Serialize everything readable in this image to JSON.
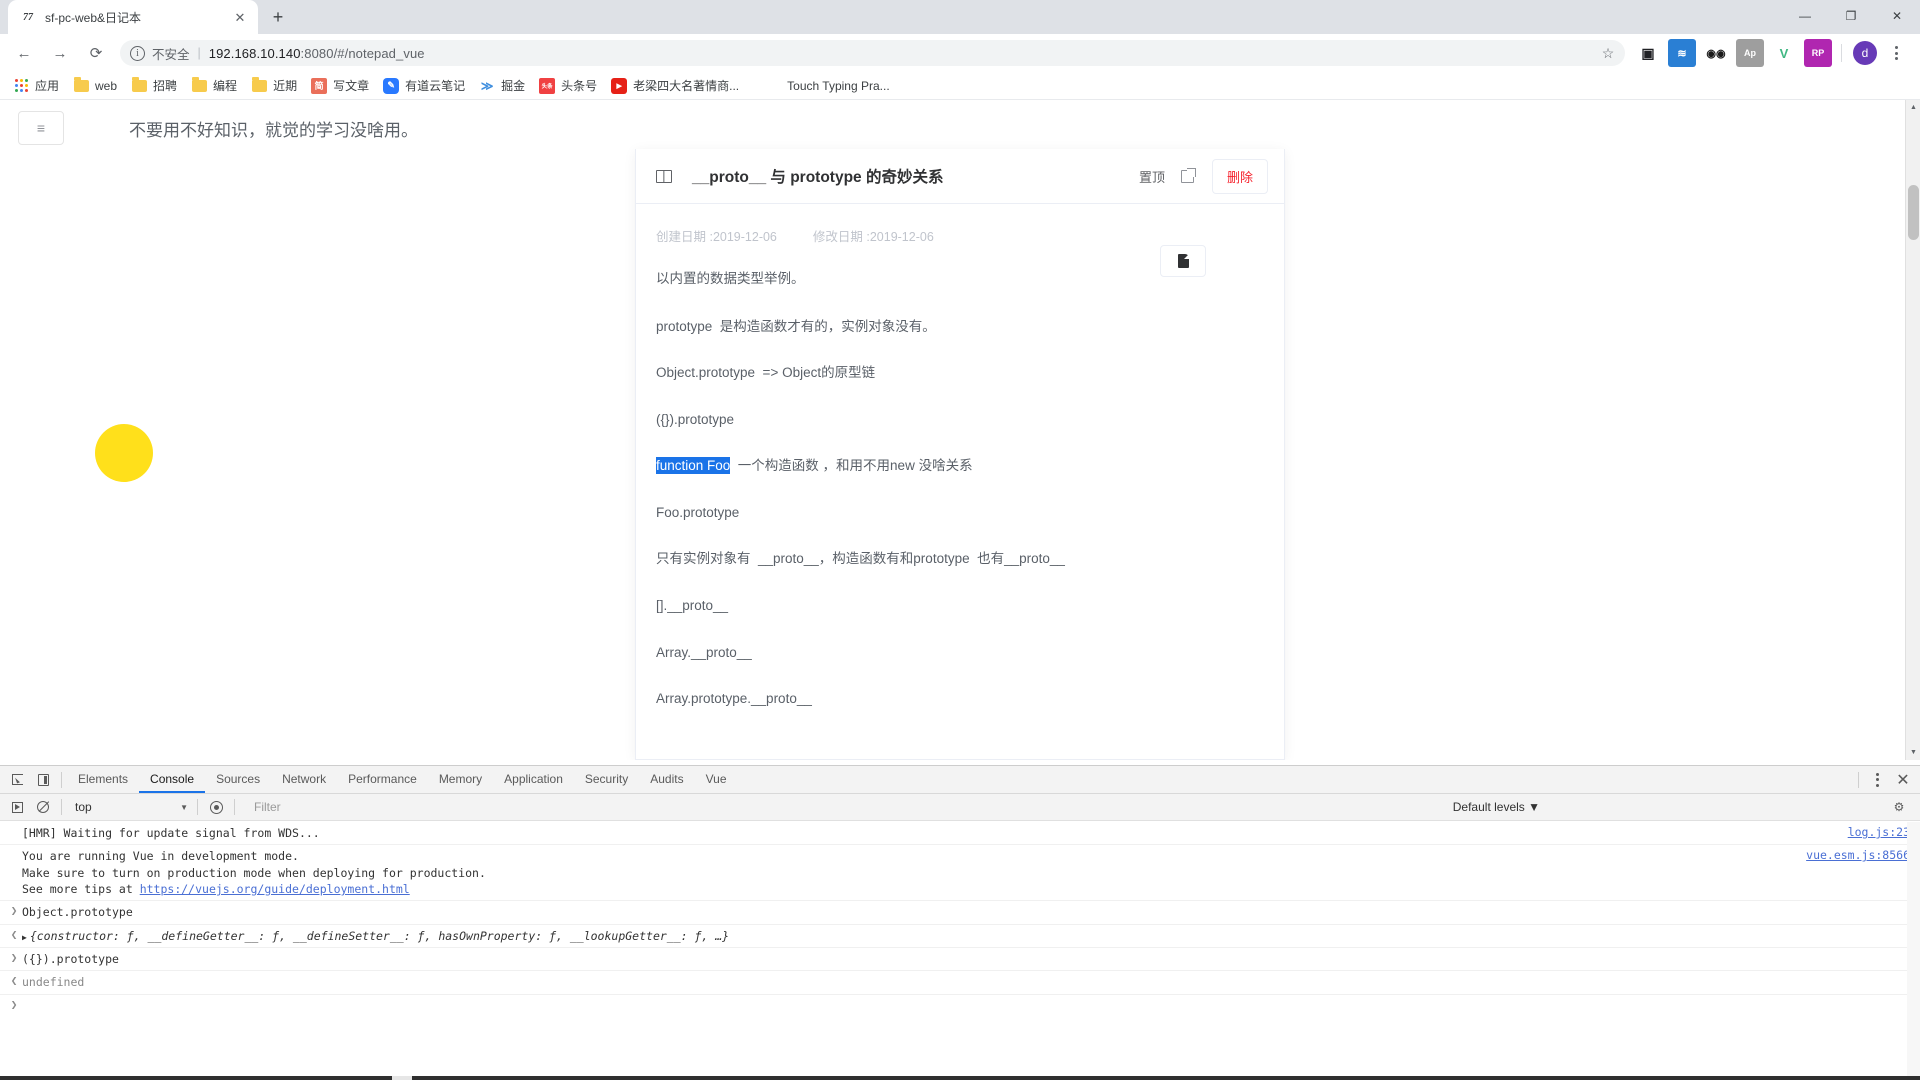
{
  "browser": {
    "tab": {
      "favicon": "77",
      "title": "sf-pc-web&日记本",
      "close_label": "✕"
    },
    "newtab_label": "+",
    "window_controls": {
      "minimize": "—",
      "maximize": "❐",
      "close": "✕"
    },
    "nav": {
      "back": "←",
      "forward": "→",
      "reload": "⟳"
    },
    "omnibox": {
      "info_icon": "i",
      "security_text": "不安全",
      "separator": "|",
      "url_host": "192.168.10.140",
      "url_rest": ":8080/#/notepad_vue",
      "star_icon": "☆"
    },
    "extensions": [
      {
        "name": "picture-in-picture-extension",
        "label": "▣",
        "bg": "#ffffff",
        "fg": "#202124"
      },
      {
        "name": "wps-extension",
        "label": "≋",
        "bg": "#2a7fd4",
        "fg": "#ffffff"
      },
      {
        "name": "glasses-extension",
        "label": "◉◉",
        "bg": "#ffffff",
        "fg": "#1a1a1a"
      },
      {
        "name": "ap-extension",
        "label": "Ap",
        "bg": "#9e9e9e",
        "fg": "#ffffff"
      },
      {
        "name": "vue-devtools-extension",
        "label": "V",
        "bg": "#ffffff",
        "fg": "#41b883"
      },
      {
        "name": "rp-extension",
        "label": "RP",
        "bg": "#b026b0",
        "fg": "#ffffff"
      }
    ],
    "profile_initial": "d",
    "bookmarks": [
      {
        "name": "apps",
        "label": "应用",
        "icon": "apps-grid"
      },
      {
        "name": "web",
        "label": "web",
        "icon": "folder"
      },
      {
        "name": "recruit",
        "label": "招聘",
        "icon": "folder"
      },
      {
        "name": "programming",
        "label": "编程",
        "icon": "folder"
      },
      {
        "name": "recent",
        "label": "近期",
        "icon": "folder"
      },
      {
        "name": "jianshu",
        "label": "写文章",
        "icon": "简",
        "bg": "#ea6f5a",
        "fg": "#ffffff"
      },
      {
        "name": "youdao",
        "label": "有道云笔记",
        "icon": "✎",
        "bg": "#2979ff",
        "fg": "#ffffff"
      },
      {
        "name": "juejin",
        "label": "掘金",
        "icon": "≫",
        "bg": "#ffffff",
        "fg": "#3f8ede"
      },
      {
        "name": "toutiao",
        "label": "头条号",
        "icon": "头条",
        "bg": "#f04142",
        "fg": "#ffffff"
      },
      {
        "name": "laoliang-video",
        "label": "老梁四大名著情商...",
        "icon": "▶",
        "bg": "#e62117",
        "fg": "#ffffff"
      },
      {
        "name": "touch-typing",
        "label": "Touch Typing Pra...",
        "icon": ""
      }
    ]
  },
  "app": {
    "menu_button_icon": "≡",
    "motto": "不要用不好知识，就觉的学习没啥用。",
    "note": {
      "book_icon": "book-icon",
      "title": "__proto__ 与 prototype 的奇妙关系",
      "pin_label": "置顶",
      "share_icon": "external-link-icon",
      "delete_label": "删除",
      "created_label": "创建日期 :2019-12-06",
      "modified_label": "修改日期 :2019-12-06",
      "copy_icon": "document-copy-icon",
      "lines": [
        {
          "text": "以内置的数据类型举例。",
          "type": "text"
        },
        {
          "text": "",
          "type": "blank"
        },
        {
          "text": "prototype  是构造函数才有的，实例对象没有。",
          "type": "text"
        },
        {
          "text": "Object.prototype  => Object的原型链",
          "type": "text"
        },
        {
          "text": "({}).prototype",
          "type": "text"
        },
        {
          "text": "",
          "type": "selected-line",
          "selected": "function Foo",
          "rest": "  一个构造函数 ，和用不用new 没啥关系"
        },
        {
          "text": "Foo.prototype",
          "type": "text"
        },
        {
          "text": "只有实例对象有  __proto__，构造函数有和prototype  也有__proto__",
          "type": "text"
        },
        {
          "text": "[].__proto__",
          "type": "text"
        },
        {
          "text": "Array.__proto__",
          "type": "text"
        },
        {
          "text": "Array.prototype.__proto__",
          "type": "text"
        }
      ]
    }
  },
  "devtools": {
    "inspect_icon": "inspect-element-icon",
    "device_icon": "device-toolbar-icon",
    "tabs": [
      {
        "label": "Elements",
        "active": false
      },
      {
        "label": "Console",
        "active": true
      },
      {
        "label": "Sources",
        "active": false
      },
      {
        "label": "Network",
        "active": false
      },
      {
        "label": "Performance",
        "active": false
      },
      {
        "label": "Memory",
        "active": false
      },
      {
        "label": "Application",
        "active": false
      },
      {
        "label": "Security",
        "active": false
      },
      {
        "label": "Audits",
        "active": false
      },
      {
        "label": "Vue",
        "active": false
      }
    ],
    "more_icon": "kebab-menu-icon",
    "close_icon": "✕",
    "filterbar": {
      "exec_icon": "execute-icon",
      "clear_icon": "clear-console-icon",
      "context": "top",
      "context_caret": "▼",
      "eye_icon": "live-expression-icon",
      "filter_placeholder": "Filter",
      "levels": "Default levels ▼",
      "settings_icon": "settings-gear-icon"
    },
    "console": [
      {
        "gutter": "",
        "text": "[HMR] Waiting for update signal from WDS...",
        "source": "log.js:23",
        "style": "plain"
      },
      {
        "gutter": "",
        "text": "You are running Vue in development mode.\nMake sure to turn on production mode when deploying for production.\nSee more tips at ",
        "link": "https://vuejs.org/guide/deployment.html",
        "source": "vue.esm.js:8566",
        "style": "plain"
      },
      {
        "gutter": "❯",
        "text": "Object.prototype",
        "style": "input"
      },
      {
        "gutter": "❮",
        "text": "{constructor: ƒ, __defineGetter__: ƒ, __defineSetter__: ƒ, hasOwnProperty: ƒ, __lookupGetter__: ƒ, …}",
        "style": "object",
        "triangle": "▶"
      },
      {
        "gutter": "❯",
        "text": "({}).prototype",
        "style": "input"
      },
      {
        "gutter": "❮",
        "text": "undefined",
        "style": "result-gray"
      },
      {
        "gutter": "❯",
        "text": "",
        "style": "prompt"
      }
    ]
  },
  "colors": {
    "accent": "#1a73e8",
    "danger": "#f5222d",
    "cursor_highlight": "#ffe01b",
    "selection": "#1a73e8"
  }
}
